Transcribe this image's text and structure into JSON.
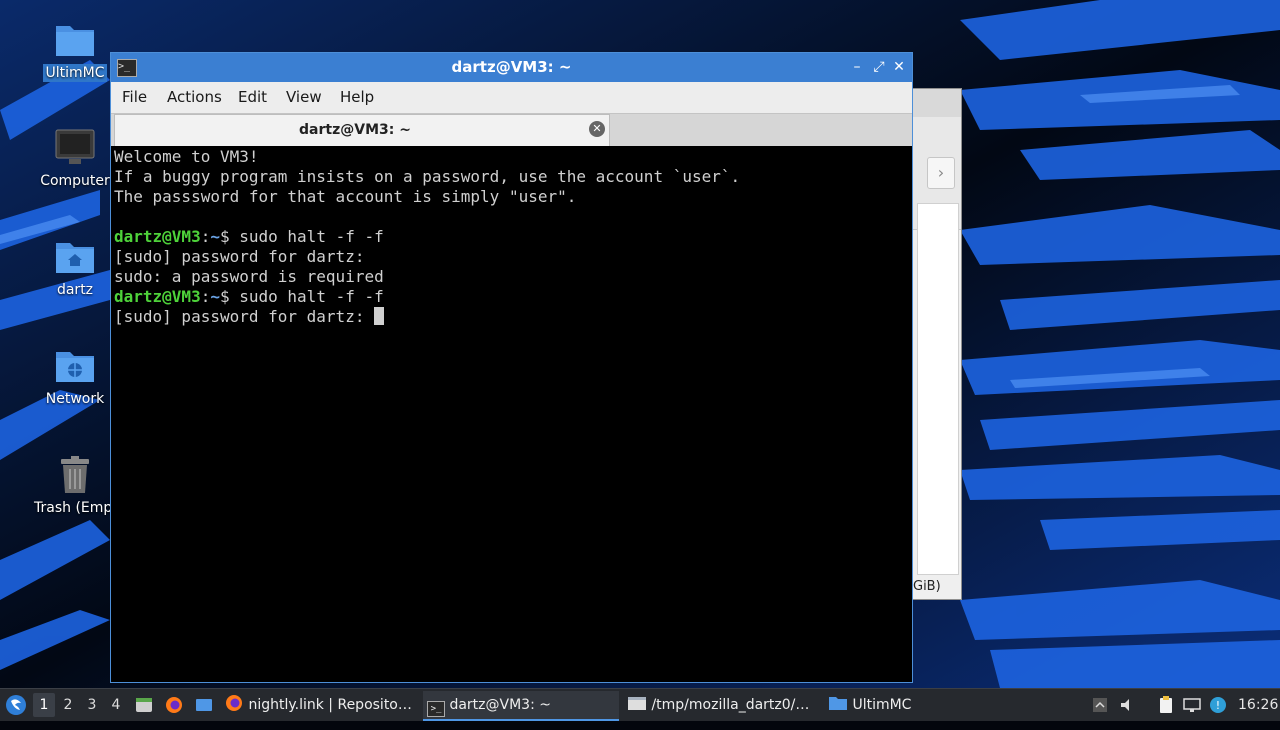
{
  "desktop": {
    "icons": [
      {
        "label": "UltimMC"
      },
      {
        "label": "Computer"
      },
      {
        "label": "dartz"
      },
      {
        "label": "Network"
      },
      {
        "label": "Trash (Empt"
      }
    ]
  },
  "background_window": {
    "status_text": "GiB)",
    "nav_glyph": "›"
  },
  "terminal": {
    "title": "dartz@VM3: ~",
    "menu": [
      "File",
      "Actions",
      "Edit",
      "View",
      "Help"
    ],
    "tab_label": "dartz@VM3: ~",
    "lines": {
      "l1": "Welcome to VM3!",
      "l2": "If a buggy program insists on a password, use the account `user`.",
      "l3": "The passsword for that account is simply \"user\".",
      "p1_user": "dartz@VM3",
      "p1_sep": ":",
      "p1_path": "~",
      "p1_cmd": "$ sudo halt -f -f",
      "l5": "[sudo] password for dartz:",
      "l6": "sudo: a password is required",
      "p2_user": "dartz@VM3",
      "p2_sep": ":",
      "p2_path": "~",
      "p2_cmd": "$ sudo halt -f -f",
      "l8": "[sudo] password for dartz: "
    }
  },
  "taskbar": {
    "workspaces": [
      "1",
      "2",
      "3",
      "4"
    ],
    "active_workspace": "1",
    "tasks": [
      {
        "label": "nightly.link | Reposito…"
      },
      {
        "label": "dartz@VM3: ~"
      },
      {
        "label": "/tmp/mozilla_dartz0/…"
      },
      {
        "label": "UltimMC"
      }
    ],
    "clock": "16:26"
  },
  "colors": {
    "titlebar": "#3b7fd2",
    "prompt_user": "#4ed23a",
    "prompt_path": "#6aa3e6",
    "taskbar": "#26292e"
  }
}
